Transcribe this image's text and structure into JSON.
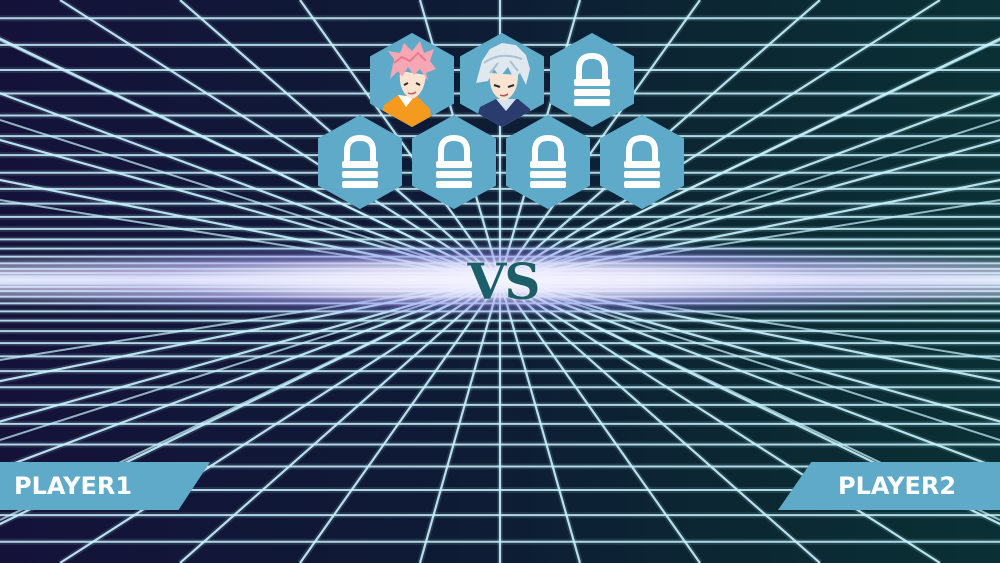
{
  "versus_label": "VS",
  "players": {
    "left": "PLAYER1",
    "right": "PLAYER2"
  },
  "roster": [
    {
      "slot": "character-1",
      "state": "unlocked",
      "icon": "pink-hair-fighter-portrait"
    },
    {
      "slot": "character-2",
      "state": "unlocked",
      "icon": "silver-hair-fighter-portrait"
    },
    {
      "slot": "character-3",
      "state": "locked",
      "icon": "lock-icon"
    },
    {
      "slot": "character-4",
      "state": "locked",
      "icon": "lock-icon"
    },
    {
      "slot": "character-5",
      "state": "locked",
      "icon": "lock-icon"
    },
    {
      "slot": "character-6",
      "state": "locked",
      "icon": "lock-icon"
    },
    {
      "slot": "character-7",
      "state": "locked",
      "icon": "lock-icon"
    }
  ],
  "colors": {
    "hex_tile": "#5fa9c9",
    "grid_line": "#c8f4ff",
    "vs_text": "#1c5f6b",
    "horizon_glow": "#ffffff"
  }
}
